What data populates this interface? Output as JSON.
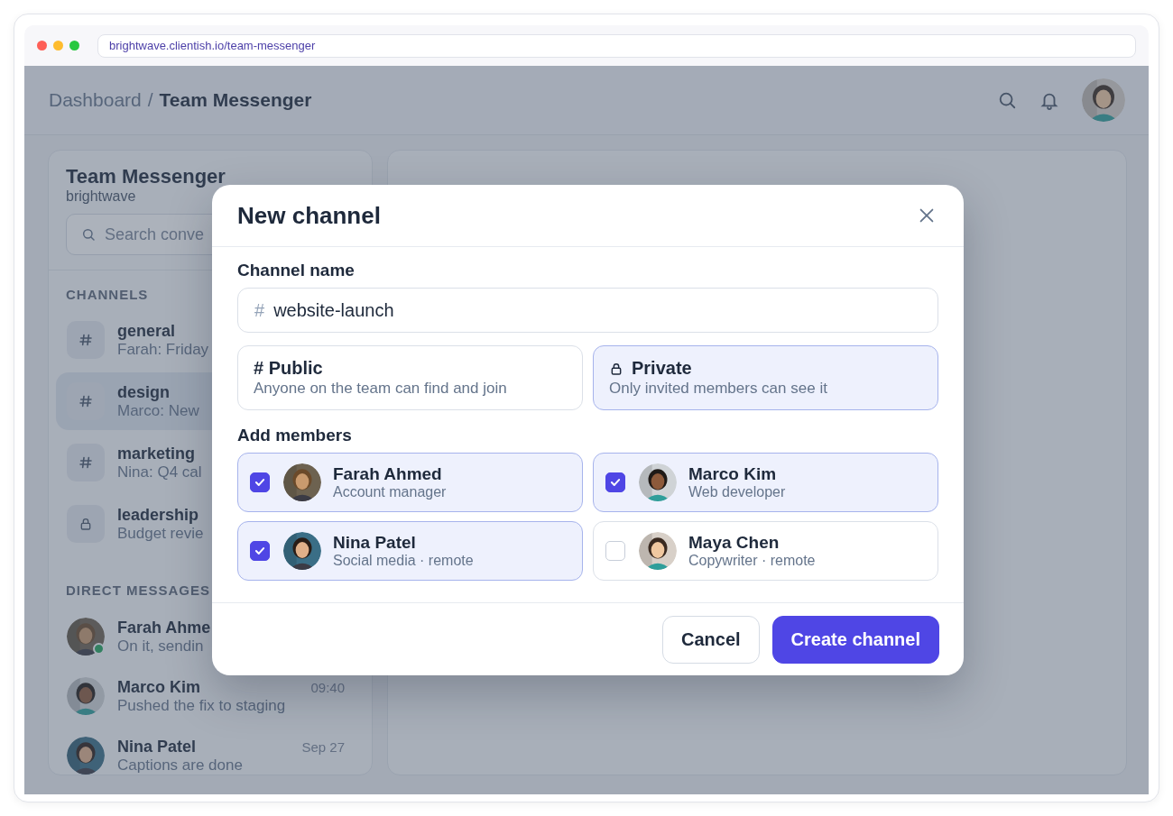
{
  "browser": {
    "url": "brightwave.clientish.io/team-messenger"
  },
  "header": {
    "breadcrumb_parent": "Dashboard",
    "separator": "/",
    "breadcrumb_current": "Team Messenger"
  },
  "sidebar": {
    "title": "Team Messenger",
    "workspace": "brightwave",
    "search": {
      "placeholder": "Search conve"
    },
    "channels_heading": "CHANNELS",
    "channels": [
      {
        "name": "general",
        "preview": "Farah: Friday",
        "kind": "public",
        "selected": false
      },
      {
        "name": "design",
        "preview": "Marco: New",
        "kind": "public",
        "selected": true
      },
      {
        "name": "marketing",
        "preview": "Nina: Q4 cal",
        "kind": "public",
        "selected": false
      },
      {
        "name": "leadership",
        "preview": "Budget revie",
        "kind": "private",
        "selected": false
      }
    ],
    "dm_heading": "DIRECT MESSAGES",
    "direct_messages": [
      {
        "name": "Farah Ahme",
        "preview": "On it, sendin",
        "online": true
      },
      {
        "name": "Marco Kim",
        "time": "09:40",
        "preview": "Pushed the fix to staging",
        "online": false
      },
      {
        "name": "Nina Patel",
        "time": "Sep 27",
        "preview": "Captions are done",
        "online": false
      }
    ]
  },
  "modal": {
    "title": "New channel",
    "name_label": "Channel name",
    "name_prefix": "#",
    "name_value": "website-launch",
    "visibility": [
      {
        "kind": "public",
        "title": "# Public",
        "description": "Anyone on the team can find and join",
        "selected": false
      },
      {
        "kind": "private",
        "title": "Private",
        "description": "Only invited members can see it",
        "selected": true
      }
    ],
    "members_label": "Add members",
    "members": [
      {
        "name": "Farah Ahmed",
        "role": "Account manager",
        "checked": true
      },
      {
        "name": "Marco Kim",
        "role": "Web developer",
        "checked": true
      },
      {
        "name": "Nina Patel",
        "role": "Social media · remote",
        "checked": true
      },
      {
        "name": "Maya Chen",
        "role": "Copywriter · remote",
        "checked": false
      }
    ],
    "buttons": [
      {
        "label": "Cancel",
        "kind": "secondary"
      },
      {
        "label": "Create channel",
        "kind": "primary"
      }
    ]
  }
}
